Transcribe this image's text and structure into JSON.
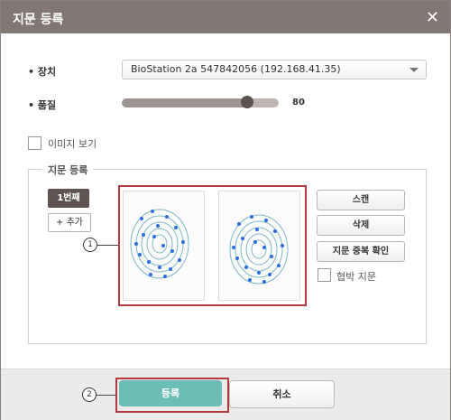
{
  "dialog": {
    "title": "지문 등록",
    "close_icon": "close-icon"
  },
  "form": {
    "device_label": "장치",
    "device_value": "BioStation 2a 547842056 (192.168.41.35)",
    "quality_label": "품질",
    "quality_value": "80",
    "quality_fraction": 0.8,
    "view_image_label": "이미지 보기"
  },
  "fingerprint_group": {
    "title": "지문 등록",
    "tab_first": "1번째",
    "add_label": "+ 추가",
    "scan_label": "스캔",
    "delete_label": "삭제",
    "duplicate_check_label": "지문 중복 확인",
    "duress_label": "협박 지문"
  },
  "callouts": {
    "one": "1",
    "two": "2"
  },
  "footer": {
    "register_label": "등록",
    "cancel_label": "취소"
  },
  "colors": {
    "titlebar": "#817773",
    "primary": "#6dbdb7",
    "highlight": "#b23a3f"
  }
}
